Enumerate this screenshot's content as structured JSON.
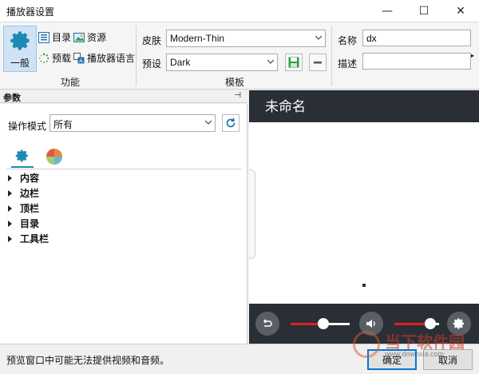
{
  "window": {
    "title": "播放器设置",
    "minimize": "—",
    "maximize": "☐",
    "close": "✕"
  },
  "ribbon": {
    "function_group": {
      "label": "功能",
      "general_label": "一般",
      "items": [
        {
          "label": "目录",
          "icon": "list-icon"
        },
        {
          "label": "资源",
          "icon": "image-icon"
        },
        {
          "label": "预载",
          "icon": "spinner-icon"
        },
        {
          "label": "播放器语言",
          "icon": "language-icon"
        }
      ]
    },
    "template_group": {
      "label": "模板",
      "skin_label": "皮肤",
      "skin_value": "Modern-Thin",
      "preset_label": "预设",
      "preset_value": "Dark"
    },
    "meta_group": {
      "name_label": "名称",
      "name_value": "dx",
      "desc_label": "描述",
      "desc_value": ""
    }
  },
  "params": {
    "header": "参数",
    "mode_label": "操作模式",
    "mode_value": "所有",
    "tree": [
      "内容",
      "边栏",
      "顶栏",
      "目录",
      "工具栏"
    ]
  },
  "preview": {
    "title": "未命名",
    "volume_level": 0.8,
    "progress_level": 0.55
  },
  "status": {
    "text": "预览窗口中可能无法提供视频和音频。",
    "ok_label": "确定",
    "cancel_label": "取消"
  },
  "watermark": {
    "text": "当下软件园",
    "url": "www.downxia.com"
  },
  "colors": {
    "accent": "#1e8ab4",
    "preview_bg": "#2a2f36",
    "slider_red": "#e02020"
  }
}
